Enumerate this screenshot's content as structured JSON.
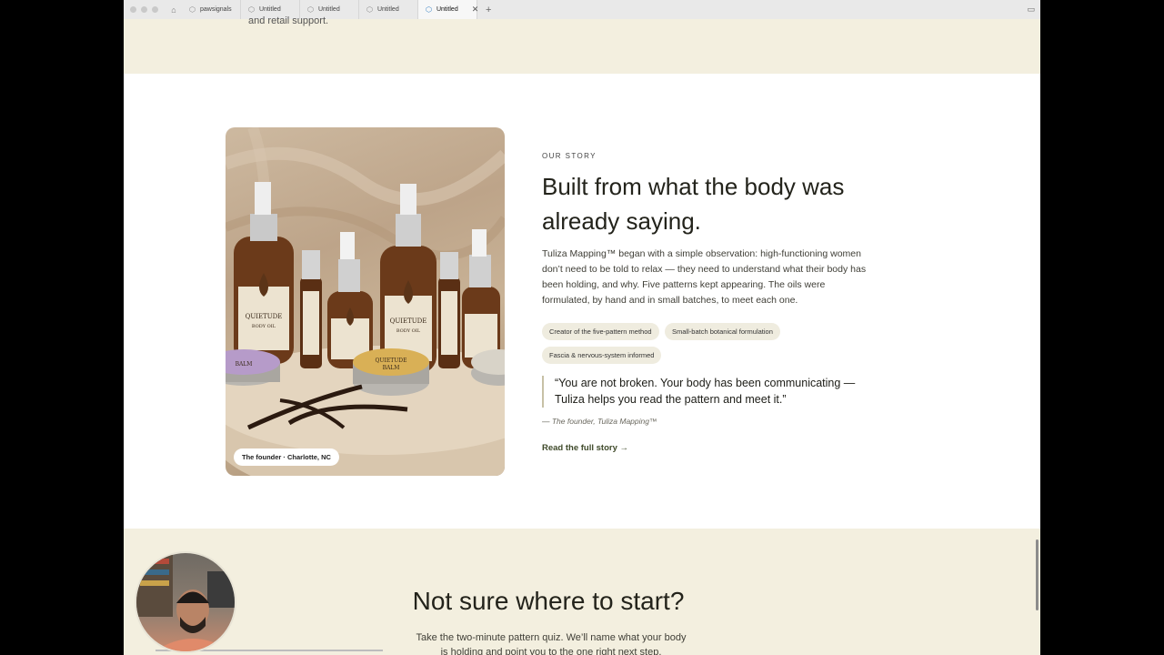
{
  "browser": {
    "tabs": [
      {
        "label": "pawsignals",
        "active": false
      },
      {
        "label": "Untitled",
        "active": false
      },
      {
        "label": "Untitled",
        "active": false
      },
      {
        "label": "Untitled",
        "active": false
      },
      {
        "label": "Untitled",
        "active": true
      }
    ],
    "new_tab": "+",
    "close": "✕"
  },
  "top_band": {
    "fragment": "and retail support."
  },
  "story": {
    "eyebrow": "OUR STORY",
    "headline": "Built from what the body was already saying.",
    "body": "Tuliza Mapping™ began with a simple observation: high-functioning women don’t need to be told to relax — they need to understand what their body has been holding, and why. Five patterns kept appearing. The oils were formulated, by hand and in small batches, to meet each one.",
    "chips": [
      "Creator of the five-pattern method",
      "Small-batch botanical formulation",
      "Fascia & nervous-system informed"
    ],
    "quote": "“You are not broken. Your body has been communicating — Tuliza helps you read the pattern and meet it.”",
    "attribution": "— The founder, Tuliza Mapping™",
    "link": "Read the full story →",
    "photo_badge": "The founder · Charlotte, NC",
    "product_labels": {
      "brand": "QUIETUDE",
      "type": "BODY OIL",
      "balm": "BALM"
    }
  },
  "cta": {
    "title": "Not sure where to start?",
    "body": "Take the two-minute pattern quiz. We’ll name what your body is holding and point you to the one right next step."
  },
  "colors": {
    "beige": "#f3efdf",
    "chip": "#efecdf",
    "text": "#23231b",
    "link": "#3f4a2a"
  }
}
